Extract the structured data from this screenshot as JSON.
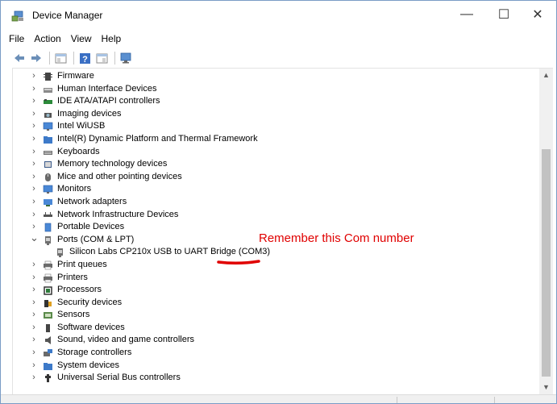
{
  "window": {
    "title": "Device Manager",
    "controls": {
      "minimize": "—",
      "maximize": "☐",
      "close": "✕"
    }
  },
  "menu": [
    "File",
    "Action",
    "View",
    "Help"
  ],
  "toolbar": {
    "icons": [
      "back-arrow-icon",
      "forward-arrow-icon",
      "show-hide-console-tree-icon",
      "help-icon",
      "properties-icon",
      "scan-hardware-icon"
    ]
  },
  "tree": {
    "rows": [
      {
        "label": "Firmware",
        "expanded": false,
        "icon": "firmware-icon"
      },
      {
        "label": "Human Interface Devices",
        "expanded": false,
        "icon": "hid-icon"
      },
      {
        "label": "IDE ATA/ATAPI controllers",
        "expanded": false,
        "icon": "ide-controller-icon"
      },
      {
        "label": "Imaging devices",
        "expanded": false,
        "icon": "camera-icon"
      },
      {
        "label": "Intel WiUSB",
        "expanded": false,
        "icon": "monitor-icon"
      },
      {
        "label": "Intel(R) Dynamic Platform and Thermal Framework",
        "expanded": false,
        "icon": "folder-icon"
      },
      {
        "label": "Keyboards",
        "expanded": false,
        "icon": "keyboard-icon"
      },
      {
        "label": "Memory technology devices",
        "expanded": false,
        "icon": "memory-icon"
      },
      {
        "label": "Mice and other pointing devices",
        "expanded": false,
        "icon": "mouse-icon"
      },
      {
        "label": "Monitors",
        "expanded": false,
        "icon": "monitor-icon"
      },
      {
        "label": "Network adapters",
        "expanded": false,
        "icon": "network-adapter-icon"
      },
      {
        "label": "Network Infrastructure Devices",
        "expanded": false,
        "icon": "network-infrastructure-icon"
      },
      {
        "label": "Portable Devices",
        "expanded": false,
        "icon": "portable-device-icon"
      },
      {
        "label": "Ports (COM & LPT)",
        "expanded": true,
        "icon": "port-icon"
      },
      {
        "label": "Silicon Labs CP210x USB to UART Bridge (COM3)",
        "child": true,
        "icon": "port-icon"
      },
      {
        "label": "Print queues",
        "expanded": false,
        "icon": "printer-icon"
      },
      {
        "label": "Printers",
        "expanded": false,
        "icon": "printer-icon"
      },
      {
        "label": "Processors",
        "expanded": false,
        "icon": "processor-icon"
      },
      {
        "label": "Security devices",
        "expanded": false,
        "icon": "security-device-icon"
      },
      {
        "label": "Sensors",
        "expanded": false,
        "icon": "sensor-icon"
      },
      {
        "label": "Software devices",
        "expanded": false,
        "icon": "software-device-icon"
      },
      {
        "label": "Sound, video and game controllers",
        "expanded": false,
        "icon": "speaker-icon"
      },
      {
        "label": "Storage controllers",
        "expanded": false,
        "icon": "storage-controller-icon"
      },
      {
        "label": "System devices",
        "expanded": false,
        "icon": "folder-icon"
      },
      {
        "label": "Universal Serial Bus controllers",
        "expanded": false,
        "icon": "usb-icon"
      }
    ]
  },
  "annotation": {
    "text": "Remember this Com number",
    "color": "#e00000"
  }
}
